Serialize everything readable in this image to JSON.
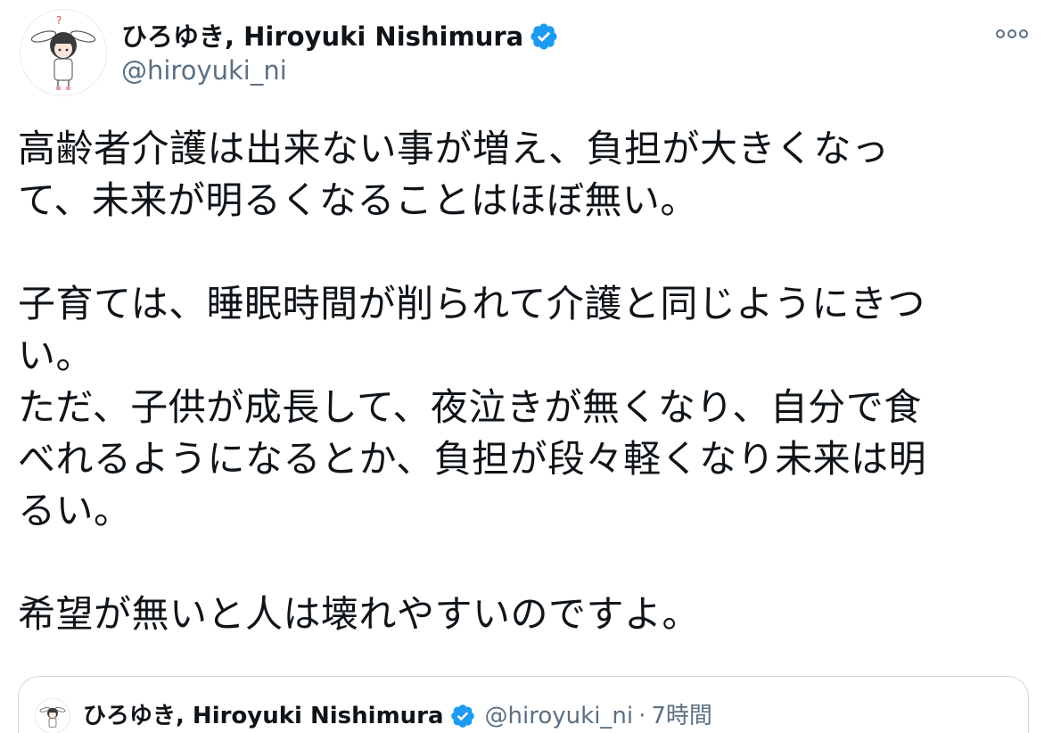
{
  "author": {
    "display_name": "ひろゆき, Hiroyuki Nishimura",
    "handle": "@hiroyuki_ni",
    "verified_icon": "verified-badge-icon"
  },
  "menu": {
    "more_icon": "more-options-icon"
  },
  "tweet": {
    "paragraphs": [
      "高齢者介護は出来ない事が増え、負担が大きくなっ\nて、未来が明るくなることはほぼ無い。",
      "子育ては、睡眠時間が削られて介護と同じようにきつ\nい。\nただ、子供が成長して、夜泣きが無くなり、自分で食\nべれるようになるとか、負担が段々軽くなり未来は明\nるい。",
      "希望が無いと人は壊れやすいのですよ。"
    ]
  },
  "quoted_tweet": {
    "display_name": "ひろゆき, Hiroyuki Nishimura",
    "handle": "@hiroyuki_ni",
    "separator": "·",
    "time": "7時間"
  },
  "colors": {
    "verified_blue": "#1d9bf0",
    "secondary_text": "#5b7083",
    "border": "#cfd9de"
  }
}
